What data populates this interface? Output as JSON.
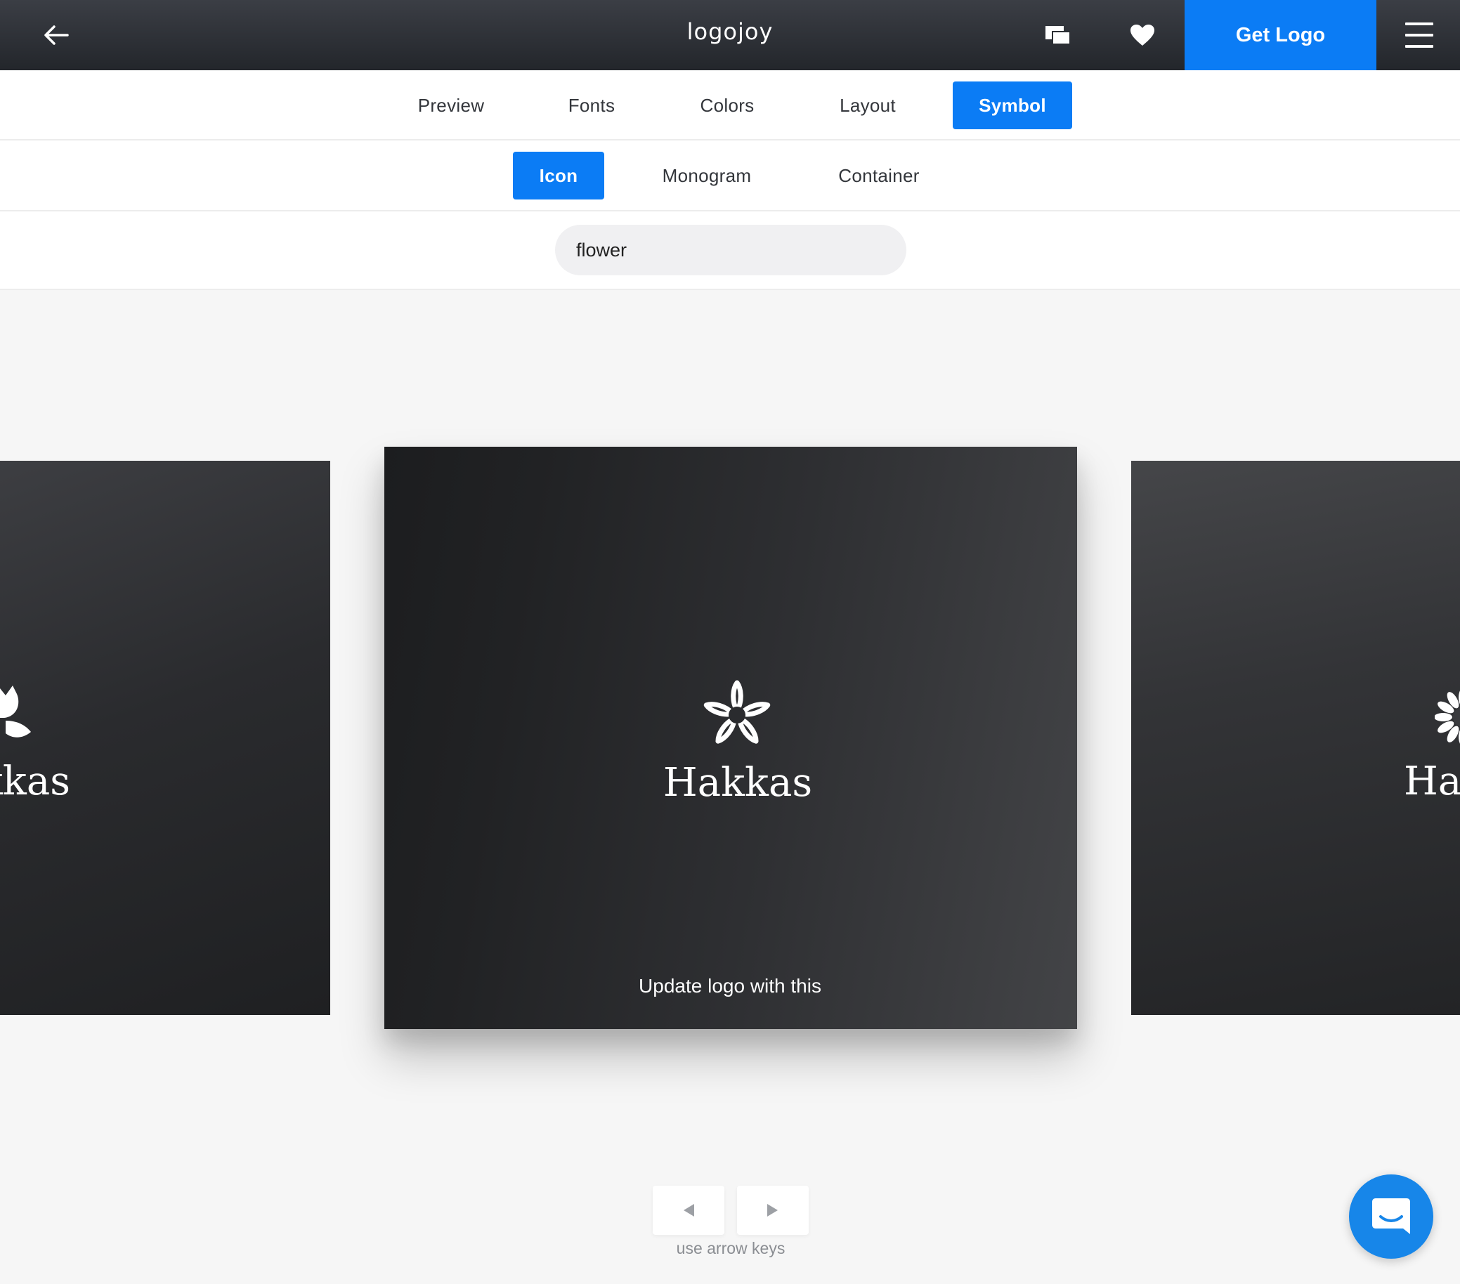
{
  "header": {
    "brand": "logojoy",
    "get_logo_label": "Get Logo",
    "icons": [
      "back-arrow-icon",
      "chat-bubbles-icon",
      "heart-icon",
      "hamburger-menu-icon"
    ]
  },
  "main_tabs": [
    {
      "label": "Preview",
      "active": false
    },
    {
      "label": "Fonts",
      "active": false
    },
    {
      "label": "Colors",
      "active": false
    },
    {
      "label": "Layout",
      "active": false
    },
    {
      "label": "Symbol",
      "active": true
    }
  ],
  "symbol_tabs": [
    {
      "label": "Icon",
      "active": true
    },
    {
      "label": "Monogram",
      "active": false
    },
    {
      "label": "Container",
      "active": false
    }
  ],
  "search": {
    "value": "flower"
  },
  "cards": {
    "left": {
      "text": "kkas",
      "icon": "tulip-icon"
    },
    "center": {
      "text": "Hakkas",
      "icon": "flower-outline-icon",
      "action_label": "Update logo with this"
    },
    "right": {
      "text": "Hal",
      "icon": "sunflower-icon"
    }
  },
  "navigation": {
    "hint": "use arrow keys"
  },
  "colors": {
    "accent": "#0b7cf5",
    "topbar": "#2b2e33",
    "chat": "#1786e9"
  }
}
